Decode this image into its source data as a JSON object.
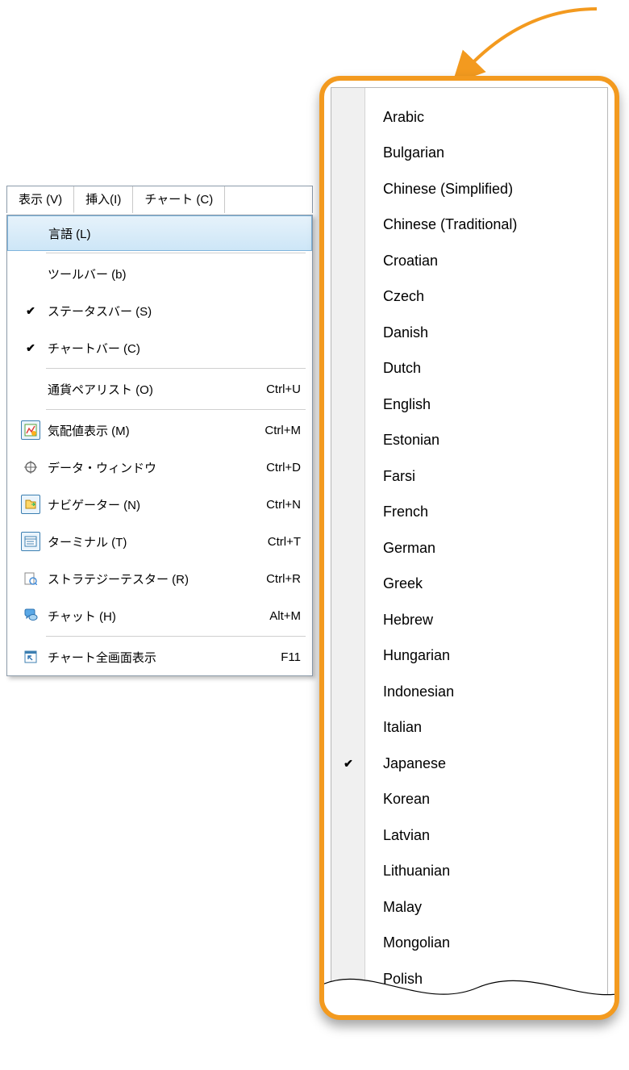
{
  "menubar": {
    "tabs": [
      {
        "label": "表示 (V)"
      },
      {
        "label": "挿入(I)"
      },
      {
        "label": "チャート (C)"
      }
    ]
  },
  "view_menu": {
    "items": [
      {
        "label": "言語 (L)",
        "shortcut": "",
        "highlight": true
      },
      {
        "sep": true
      },
      {
        "label": "ツールバー (b)",
        "shortcut": ""
      },
      {
        "label": "ステータスバー (S)",
        "shortcut": "",
        "checked": true
      },
      {
        "label": "チャートバー (C)",
        "shortcut": "",
        "checked": true
      },
      {
        "sep": true
      },
      {
        "label": "通貨ペアリスト (O)",
        "shortcut": "Ctrl+U"
      },
      {
        "sep": true
      },
      {
        "label": "気配値表示 (M)",
        "shortcut": "Ctrl+M",
        "icon": "market-watch-icon",
        "boxed": true
      },
      {
        "label": "データ・ウィンドウ",
        "shortcut": "Ctrl+D",
        "icon": "crosshair-icon"
      },
      {
        "label": "ナビゲーター (N)",
        "shortcut": "Ctrl+N",
        "icon": "navigator-icon",
        "boxed": true
      },
      {
        "label": "ターミナル (T)",
        "shortcut": "Ctrl+T",
        "icon": "terminal-icon",
        "boxed": true
      },
      {
        "label": "ストラテジーテスター (R)",
        "shortcut": "Ctrl+R",
        "icon": "strategy-tester-icon"
      },
      {
        "label": "チャット (H)",
        "shortcut": "Alt+M",
        "icon": "chat-icon"
      },
      {
        "sep": true
      },
      {
        "label": "チャート全画面表示",
        "shortcut": "F11",
        "icon": "fullscreen-icon"
      }
    ]
  },
  "languages": {
    "items": [
      {
        "name": "Arabic"
      },
      {
        "name": "Bulgarian"
      },
      {
        "name": "Chinese (Simplified)"
      },
      {
        "name": "Chinese (Traditional)"
      },
      {
        "name": "Croatian"
      },
      {
        "name": "Czech"
      },
      {
        "name": "Danish"
      },
      {
        "name": "Dutch"
      },
      {
        "name": "English"
      },
      {
        "name": "Estonian"
      },
      {
        "name": "Farsi"
      },
      {
        "name": "French"
      },
      {
        "name": "German"
      },
      {
        "name": "Greek"
      },
      {
        "name": "Hebrew"
      },
      {
        "name": "Hungarian"
      },
      {
        "name": "Indonesian"
      },
      {
        "name": "Italian"
      },
      {
        "name": "Japanese",
        "checked": true
      },
      {
        "name": "Korean"
      },
      {
        "name": "Latvian"
      },
      {
        "name": "Lithuanian"
      },
      {
        "name": "Malay"
      },
      {
        "name": "Mongolian"
      },
      {
        "name": "Polish"
      }
    ]
  },
  "colors": {
    "accent": "#f39a1f",
    "highlight_border": "#7eb4dc"
  }
}
